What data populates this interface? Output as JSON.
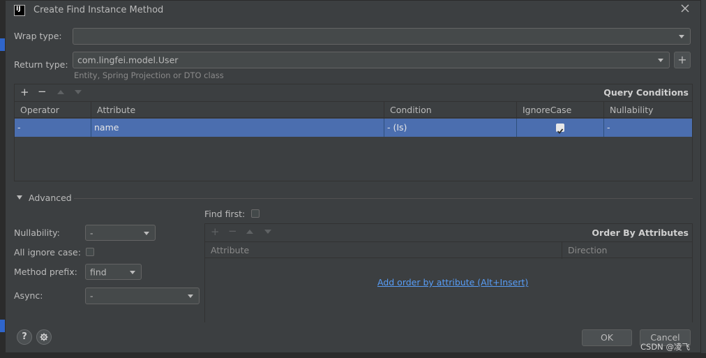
{
  "window": {
    "title": "Create Find Instance Method",
    "app_icon": "IJ"
  },
  "form": {
    "wrap_type_label": "Wrap type:",
    "wrap_type_value": "",
    "return_type_label": "Return type:",
    "return_type_value": "com.lingfei.model.User",
    "return_type_hint": "Entity, Spring Projection or DTO class",
    "add_button": "+"
  },
  "query_conditions": {
    "title": "Query Conditions",
    "columns": [
      "Operator",
      "Attribute",
      "Condition",
      "IgnoreCase",
      "Nullability"
    ],
    "rows": [
      {
        "operator": "-",
        "attribute": "name",
        "condition": "- (Is)",
        "ignore_case": true,
        "nullability": "-"
      }
    ]
  },
  "advanced": {
    "label": "Advanced",
    "find_first_label": "Find first:",
    "nullability_label": "Nullability:",
    "nullability_value": "-",
    "all_ignore_case_label": "All ignore case:",
    "method_prefix_label": "Method prefix:",
    "method_prefix_value": "find",
    "async_label": "Async:",
    "async_value": "-"
  },
  "order_by": {
    "title": "Order By Attributes",
    "columns": [
      "Attribute",
      "Direction"
    ],
    "empty_link": "Add order by attribute (Alt+Insert)"
  },
  "footer": {
    "ok": "OK",
    "cancel": "Cancel",
    "help": "?",
    "watermark": "CSDN @凌飞"
  },
  "colors": {
    "selection": "#4b6eaf",
    "link": "#589df6",
    "background": "#3c3f41"
  }
}
